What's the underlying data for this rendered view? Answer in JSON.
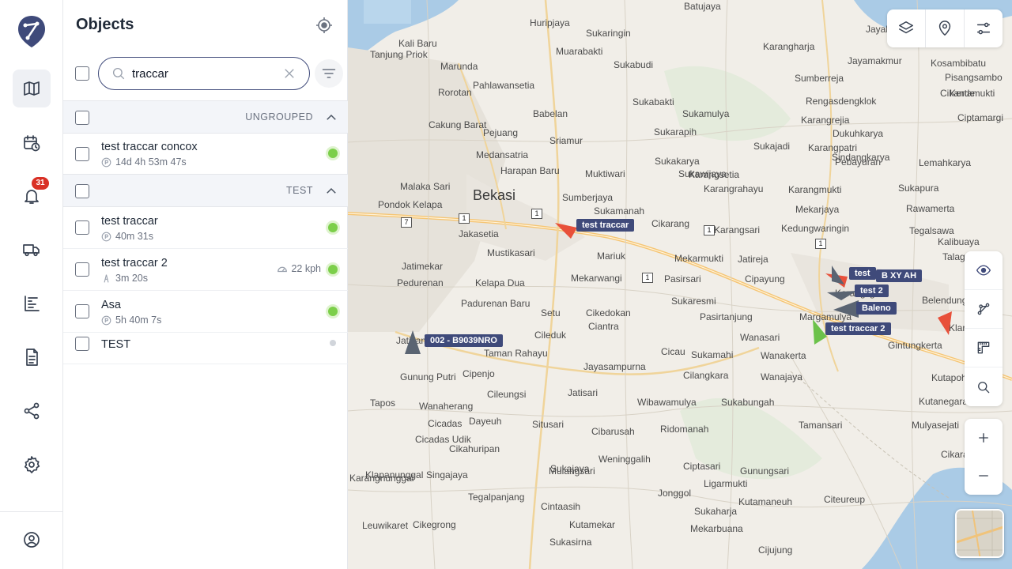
{
  "sidebar": {
    "notification_count": "31"
  },
  "panel": {
    "title": "Objects",
    "search_value": "traccar",
    "groups": [
      {
        "name": "UNGROUPED"
      },
      {
        "name": "TEST"
      }
    ],
    "objects": [
      {
        "name": "test traccar concox",
        "status": "14d 4h 53m 47s",
        "state": "online"
      },
      {
        "name": "test traccar",
        "status": "40m 31s",
        "state": "online"
      },
      {
        "name": "test traccar 2",
        "status": "3m 20s",
        "speed": "22 kph",
        "state": "online"
      },
      {
        "name": "Asa",
        "status": "5h 40m 7s",
        "state": "online"
      },
      {
        "name": "TEST",
        "state": "offline"
      }
    ]
  },
  "map": {
    "places": [
      {
        "name": "Batujaya",
        "cls": ""
      },
      {
        "name": "Huripjaya",
        "cls": ""
      },
      {
        "name": "Sukaringin",
        "cls": ""
      },
      {
        "name": "Karangharja",
        "cls": ""
      },
      {
        "name": "Jayakerta",
        "cls": ""
      },
      {
        "name": "Kali Baru",
        "cls": ""
      },
      {
        "name": "Muarabakti",
        "cls": ""
      },
      {
        "name": "Jayamakmur",
        "cls": ""
      },
      {
        "name": "Kosambibatu",
        "cls": ""
      },
      {
        "name": "Tanjung Priok",
        "cls": ""
      },
      {
        "name": "Marunda",
        "cls": ""
      },
      {
        "name": "Sukabudi",
        "cls": ""
      },
      {
        "name": "Sumberreja",
        "cls": ""
      },
      {
        "name": "Pisangsambo",
        "cls": ""
      },
      {
        "name": "Kertamukti",
        "cls": ""
      },
      {
        "name": "Rorotan",
        "cls": ""
      },
      {
        "name": "Pahlawansetia",
        "cls": ""
      },
      {
        "name": "Sukabakti",
        "cls": ""
      },
      {
        "name": "Cikande",
        "cls": ""
      },
      {
        "name": "Babelan",
        "cls": ""
      },
      {
        "name": "Sukamulya",
        "cls": ""
      },
      {
        "name": "Rengasdengklok",
        "cls": ""
      },
      {
        "name": "Cakung Barat",
        "cls": ""
      },
      {
        "name": "Karangrejia",
        "cls": ""
      },
      {
        "name": "Ciptamargi",
        "cls": ""
      },
      {
        "name": "Pejuang",
        "cls": ""
      },
      {
        "name": "Sukarapih",
        "cls": ""
      },
      {
        "name": "Dukuhkarya",
        "cls": ""
      },
      {
        "name": "Sriamur",
        "cls": ""
      },
      {
        "name": "Karangpatri",
        "cls": ""
      },
      {
        "name": "Medansatria",
        "cls": ""
      },
      {
        "name": "Sukakarya",
        "cls": ""
      },
      {
        "name": "Sukajadi",
        "cls": ""
      },
      {
        "name": "Pebayuran",
        "cls": ""
      },
      {
        "name": "Sindangkarya",
        "cls": ""
      },
      {
        "name": "Lemahkarya",
        "cls": ""
      },
      {
        "name": "Harapan Baru",
        "cls": ""
      },
      {
        "name": "Muktiwari",
        "cls": ""
      },
      {
        "name": "Sukawijaya",
        "cls": ""
      },
      {
        "name": "Karangsetia",
        "cls": ""
      },
      {
        "name": "Malaka Sari",
        "cls": ""
      },
      {
        "name": "Karangrahayu",
        "cls": ""
      },
      {
        "name": "Bekasi",
        "cls": "city"
      },
      {
        "name": "Sumberjaya",
        "cls": ""
      },
      {
        "name": "Karangmukti",
        "cls": ""
      },
      {
        "name": "Sukapura",
        "cls": ""
      },
      {
        "name": "Pondok Kelapa",
        "cls": ""
      },
      {
        "name": "Sukamanah",
        "cls": ""
      },
      {
        "name": "Mekarjaya",
        "cls": ""
      },
      {
        "name": "Rawamerta",
        "cls": ""
      },
      {
        "name": "Jakasetia",
        "cls": ""
      },
      {
        "name": "Cikarang",
        "cls": ""
      },
      {
        "name": "Karangsari",
        "cls": ""
      },
      {
        "name": "Kedungwaringin",
        "cls": ""
      },
      {
        "name": "Tegalsawa",
        "cls": ""
      },
      {
        "name": "Kalibuaya",
        "cls": ""
      },
      {
        "name": "Jatimekar",
        "cls": ""
      },
      {
        "name": "Mustikasari",
        "cls": ""
      },
      {
        "name": "Mariuk",
        "cls": ""
      },
      {
        "name": "Mekarmukti",
        "cls": ""
      },
      {
        "name": "Jatireja",
        "cls": ""
      },
      {
        "name": "Talagasari",
        "cls": ""
      },
      {
        "name": "Pedurenan",
        "cls": ""
      },
      {
        "name": "Kelapa Dua",
        "cls": ""
      },
      {
        "name": "Mekarwangi",
        "cls": ""
      },
      {
        "name": "Pasirsari",
        "cls": ""
      },
      {
        "name": "Cipayung",
        "cls": ""
      },
      {
        "name": "Karangligar",
        "cls": ""
      },
      {
        "name": "Padurenan Baru",
        "cls": ""
      },
      {
        "name": "Cikedokan",
        "cls": ""
      },
      {
        "name": "Sukaresmi",
        "cls": ""
      },
      {
        "name": "Pasirtanjung",
        "cls": ""
      },
      {
        "name": "Margamulya",
        "cls": ""
      },
      {
        "name": "Belendung",
        "cls": ""
      },
      {
        "name": "Setu",
        "cls": ""
      },
      {
        "name": "Ciantra",
        "cls": ""
      },
      {
        "name": "Klari",
        "cls": ""
      },
      {
        "name": "Cileduk",
        "cls": ""
      },
      {
        "name": "Wanasari",
        "cls": ""
      },
      {
        "name": "Gintungkerta",
        "cls": ""
      },
      {
        "name": "Jatisampurna",
        "cls": ""
      },
      {
        "name": "Taman Rahayu",
        "cls": ""
      },
      {
        "name": "Cicau",
        "cls": ""
      },
      {
        "name": "Sukamahi",
        "cls": ""
      },
      {
        "name": "Wanakerta",
        "cls": ""
      },
      {
        "name": "Jayasampurna",
        "cls": ""
      },
      {
        "name": "Cilangkara",
        "cls": ""
      },
      {
        "name": "Wanajaya",
        "cls": ""
      },
      {
        "name": "Kutapohaci",
        "cls": ""
      },
      {
        "name": "Gunung Putri",
        "cls": ""
      },
      {
        "name": "Cipenjo",
        "cls": ""
      },
      {
        "name": "Cileungsi",
        "cls": ""
      },
      {
        "name": "Jatisari",
        "cls": ""
      },
      {
        "name": "Wibawamulya",
        "cls": ""
      },
      {
        "name": "Sukabungah",
        "cls": ""
      },
      {
        "name": "Kutanegara",
        "cls": ""
      },
      {
        "name": "Tapos",
        "cls": ""
      },
      {
        "name": "Wanaherang",
        "cls": ""
      },
      {
        "name": "Cicadas",
        "cls": ""
      },
      {
        "name": "Dayeuh",
        "cls": ""
      },
      {
        "name": "Situsari",
        "cls": ""
      },
      {
        "name": "Cibarusah",
        "cls": ""
      },
      {
        "name": "Ridomanah",
        "cls": ""
      },
      {
        "name": "Tamansari",
        "cls": ""
      },
      {
        "name": "Mulyasejati",
        "cls": ""
      },
      {
        "name": "Cicadas Udik",
        "cls": ""
      },
      {
        "name": "Cikahuripan",
        "cls": ""
      },
      {
        "name": "Cikarageman",
        "cls": ""
      },
      {
        "name": "Karangnunggal",
        "cls": ""
      },
      {
        "name": "Weninggalih",
        "cls": ""
      },
      {
        "name": "Sukajaya",
        "cls": ""
      },
      {
        "name": "Ciptasari",
        "cls": ""
      },
      {
        "name": "Gunungsari",
        "cls": ""
      },
      {
        "name": "Klapanunggal",
        "cls": ""
      },
      {
        "name": "Singajaya",
        "cls": ""
      },
      {
        "name": "Mulangsari",
        "cls": ""
      },
      {
        "name": "Ligarmukti",
        "cls": ""
      },
      {
        "name": "Tegalpanjang",
        "cls": ""
      },
      {
        "name": "Jonggol",
        "cls": ""
      },
      {
        "name": "Cintaasih",
        "cls": ""
      },
      {
        "name": "Kutamaneuh",
        "cls": ""
      },
      {
        "name": "Citeureup",
        "cls": ""
      },
      {
        "name": "Leuwikaret",
        "cls": ""
      },
      {
        "name": "Cikegrong",
        "cls": ""
      },
      {
        "name": "Kutamekar",
        "cls": ""
      },
      {
        "name": "Sukaharja",
        "cls": ""
      },
      {
        "name": "Sukasirna",
        "cls": ""
      },
      {
        "name": "Mekarbuana",
        "cls": ""
      },
      {
        "name": "Cijujung",
        "cls": ""
      }
    ],
    "shields": [
      "1",
      "1",
      "1",
      "1",
      "1",
      "7"
    ],
    "markers": [
      {
        "label": "test traccar",
        "color": "#e8503a"
      },
      {
        "label": "002 - B9039NRO",
        "color": "#5a6472"
      },
      {
        "label": "test",
        "color": "#e8503a"
      },
      {
        "label": "B XY AH",
        "color": "#5a6472"
      },
      {
        "label": "test 2",
        "color": "#5a6472"
      },
      {
        "label": "Baleno",
        "color": "#5a6472"
      },
      {
        "label": "test traccar 2",
        "color": "#6cc24a"
      }
    ]
  },
  "colors": {
    "accent": "#3f4a7a",
    "online": "#7ccf4a",
    "badge": "#d93025"
  }
}
